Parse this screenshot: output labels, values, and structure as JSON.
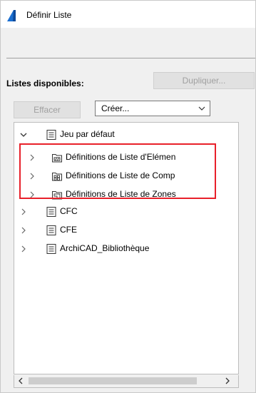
{
  "window": {
    "title": "Définir Liste"
  },
  "lists": {
    "label": "Listes disponibles:",
    "duplicate_label": "Dupliquer...",
    "delete_label": "Effacer",
    "create_select": {
      "value": "Créer..."
    }
  },
  "tree": {
    "root": {
      "label": "Jeu par défaut",
      "expanded": true
    },
    "children": [
      {
        "label": "Définitions de Liste d'Elémen",
        "icon": "element-list-icon"
      },
      {
        "label": "Définitions de Liste de Comp",
        "icon": "component-list-icon"
      },
      {
        "label": "Définitions de Liste de Zones",
        "icon": "zone-list-icon"
      }
    ],
    "others": [
      {
        "label": "CFC"
      },
      {
        "label": "CFE"
      },
      {
        "label": "ArchiCAD_Bibliothèque"
      }
    ]
  },
  "colors": {
    "highlight_border": "#e8202a",
    "disabled_text": "#a0a0a0",
    "app_icon_blue": "#1b6fd1"
  }
}
